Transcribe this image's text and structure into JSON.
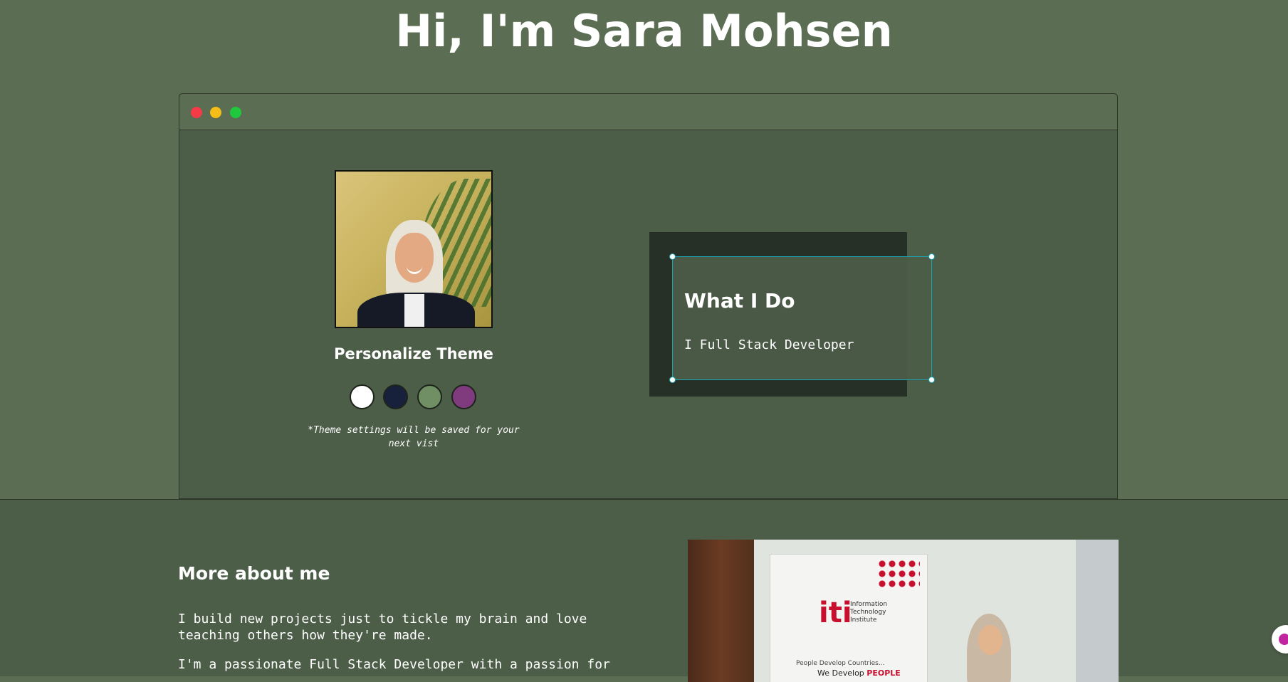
{
  "hero": {
    "title": "Hi, I'm Sara Mohsen"
  },
  "window": {
    "controls": [
      {
        "name": "close",
        "color": "#f53b47"
      },
      {
        "name": "minimize",
        "color": "#f5bd18"
      },
      {
        "name": "maximize",
        "color": "#1fc83c"
      }
    ]
  },
  "theme": {
    "heading": "Personalize Theme",
    "note": "*Theme settings will be saved for your next vist",
    "swatches": [
      {
        "name": "light",
        "color": "#ffffff"
      },
      {
        "name": "blue",
        "color": "#17213b"
      },
      {
        "name": "green",
        "color": "#718f64"
      },
      {
        "name": "purple",
        "color": "#7f3b7d"
      }
    ]
  },
  "what_i_do": {
    "title": "What I Do",
    "text": "I Full Stack Developer"
  },
  "about": {
    "heading": "More about me",
    "p1": "I build new projects just to tickle my brain and love teaching others how they're made.",
    "p2": "I'm a passionate Full Stack Developer with a passion for",
    "photo": {
      "logo_mark": "iti",
      "logo_words": [
        "Information",
        "Technology",
        "Institute"
      ],
      "tagline_1": "People Develop Countries...",
      "tagline_2_prefix": "We Develop ",
      "tagline_2_emphasis": "PEOPLE"
    }
  },
  "colors": {
    "page_bg": "#5b6e54",
    "window_bg": "#4c5d48",
    "card_bg": "#273026",
    "selection_border": "#1aa6b7",
    "text": "#ffffff"
  }
}
